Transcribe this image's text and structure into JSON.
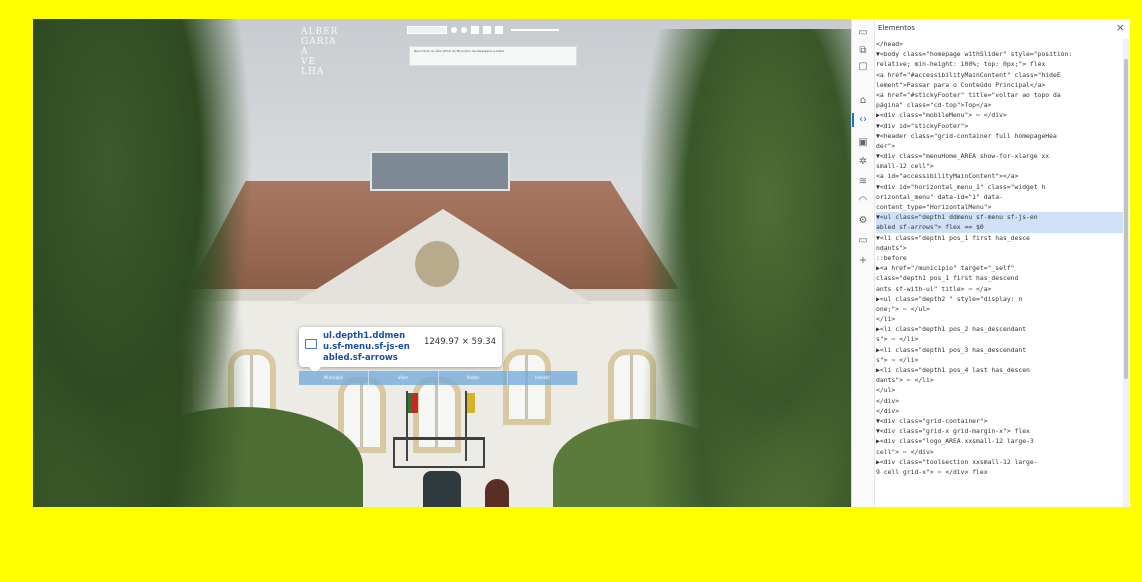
{
  "site": {
    "logo_lines": [
      "ALBER",
      "GARIA",
      "A",
      "VE",
      "LHA"
    ],
    "notice_text": "Bem-Vindo ao site oficial do Município de Albergaria-a-Velha",
    "menu_items": [
      "Município",
      "Viver",
      "Visitar",
      "Investir"
    ]
  },
  "tooltip": {
    "selector": "ul.depth1.ddmenu.sf-menu.sf-js-enabled.sf-arrows",
    "size": "1249.97 × 59.34"
  },
  "devtools": {
    "panel_title": "Elementos",
    "close_label": "×",
    "activity_icons": [
      "device-icon",
      "copy-icon",
      "window-icon",
      "home-icon",
      "code-icon",
      "console-icon",
      "bug-icon",
      "wifi-icon",
      "performance-icon",
      "settings-icon",
      "application-icon",
      "plus-icon"
    ],
    "lines": [
      "</head>",
      "▼<body class=\"homepage withSlider\" style=\"position:",
      "relative; min-height: 100%; top: 0px;\"> flex",
      "  <a href=\"#accessibilityMainContent\" class=\"hideE",
      "  lement\">Passar para o Conteúdo Principal</a>",
      "  <a href=\"#stickyFooter\" title=\"voltar ao topo da",
      "  página\" class=\"cd-top\">Top</a>",
      " ▶<div class=\"mobileMenu\"> ⋯ </div>",
      " ▼<div id=\"stickyFooter\">",
      "   ▼<header class=\"grid-container full homepageHea",
      "    der\">",
      "     ▼<div class=\"menuHome_AREA show-for-xlarge xx",
      "      small-12 cell\">",
      "        <a id=\"accessibilityMainContent\"></a>",
      "       ▼<div id=\"horizontal_menu_1\" class=\"widget h",
      "        orizontal_menu\" data-id=\"1\" data-",
      "        content_type=\"HorizontalMenu\">",
      "         ▼<ul class=\"depth1 ddmenu sf-menu sf-js-en",
      "          abled sf-arrows\"> flex  == $0",
      "           ▼<li class=\"depth1 pos_1 first has_desce",
      "            ndants\">",
      "              ::before",
      "             ▶<a href=\"/municipio\" target=\"_self\"",
      "              class=\"depth1 pos_1 first has_descend",
      "              ants sf-with-ul\" title> ⋯ </a>",
      "             ▶<ul class=\"depth2 \" style=\"display: n",
      "              one;\"> ⋯ </ul>",
      "            </li>",
      "           ▶<li class=\"depth1 pos_2 has_descendant",
      "            s\"> ⋯ </li>",
      "           ▶<li class=\"depth1 pos_3 has_descendant",
      "            s\"> ⋯ </li>",
      "           ▶<li class=\"depth1 pos_4 last has_descen",
      "            dants\"> ⋯ </li>",
      "          </ul>",
      "        </div>",
      "      </div>",
      "     ▼<div class=\"grid-container\">",
      "       ▼<div class=\"grid-x grid-margin-x\"> flex",
      "         ▶<div class=\"logo_AREA xxsmall-12 large-3",
      "          cell\"> ⋯ </div>",
      "         ▶<div class=\"toolsection xxsmall-12 large-",
      "          9 cell grid-x\"> ⋯ </div> flex"
    ],
    "selected_line_index": 17
  }
}
